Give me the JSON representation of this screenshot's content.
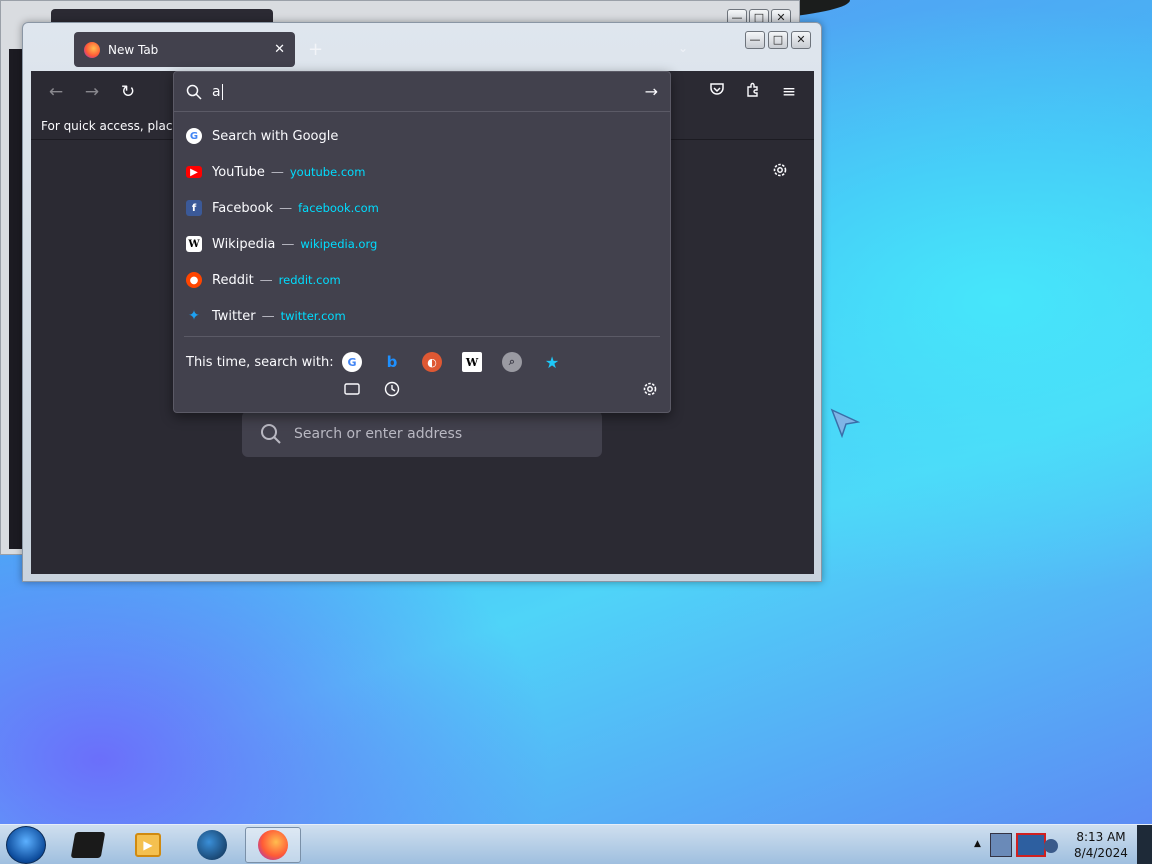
{
  "window": {
    "tab_title": "New Tab",
    "tab_close": "✕",
    "new_tab": "+",
    "minimize": "—",
    "maximize": "□",
    "close": "✕"
  },
  "toolbar": {
    "back": "←",
    "forward": "→",
    "reload": "↻",
    "menu": "≡"
  },
  "bookmarks_bar": {
    "text": "For quick access, place yo"
  },
  "urlbar": {
    "query": "a",
    "go_arrow": "→",
    "results": [
      {
        "title": "Search with Google",
        "url": "",
        "icon": "google-icon",
        "color": "#4285f4"
      },
      {
        "title": "YouTube",
        "url": "youtube.com",
        "icon": "youtube-icon",
        "color": "#ff0000"
      },
      {
        "title": "Facebook",
        "url": "facebook.com",
        "icon": "facebook-icon",
        "color": "#3b5998"
      },
      {
        "title": "Wikipedia",
        "url": "wikipedia.org",
        "icon": "wikipedia-icon",
        "color": "#ffffff"
      },
      {
        "title": "Reddit",
        "url": "reddit.com",
        "icon": "reddit-icon",
        "color": "#ff4500"
      },
      {
        "title": "Twitter",
        "url": "twitter.com",
        "icon": "twitter-icon",
        "color": "#1da1f2"
      }
    ],
    "separator": "—",
    "one_off_label": "This time, search with:"
  },
  "newtab": {
    "search_placeholder": "Search or enter address"
  },
  "taskbar": {
    "time": "8:13 AM",
    "date": "8/4/2024"
  }
}
